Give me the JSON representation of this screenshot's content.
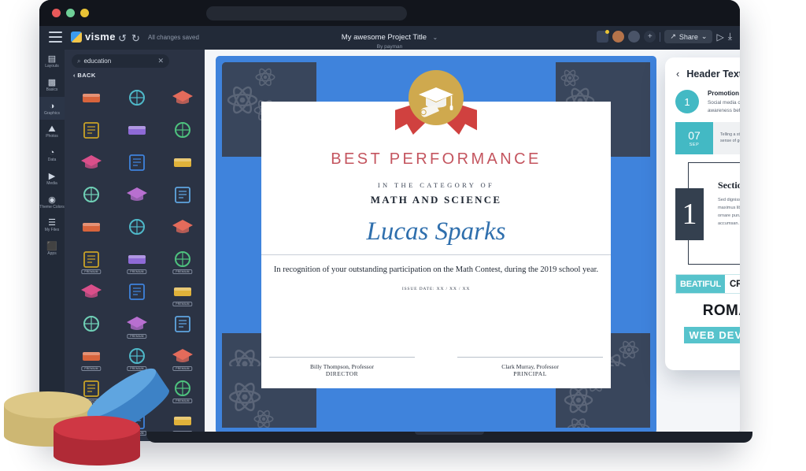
{
  "window": {
    "traffic_lights": [
      "red",
      "green",
      "yellow"
    ]
  },
  "toolbar": {
    "menu_icon": "hamburger-icon",
    "brand": "visme",
    "undo": "↺",
    "redo": "↻",
    "save_status": "All changes saved",
    "doc_title": "My awesome Project Title",
    "doc_title_caret": "⌄",
    "doc_author": "By payman",
    "share_label": "Share",
    "share_icon": "↗",
    "share_caret": "⌄",
    "present_icon": "▷",
    "download_icon": "⤓",
    "comments_icon": "❐",
    "avatar_plus": "+"
  },
  "rail": {
    "items": [
      {
        "label": "Layouts",
        "glyph": "▤",
        "icon": "layouts-icon",
        "active": false
      },
      {
        "label": "Basics",
        "glyph": "▩",
        "icon": "basics-icon",
        "active": false
      },
      {
        "label": "Graphics",
        "glyph": "◑",
        "icon": "graphics-icon",
        "active": true
      },
      {
        "label": "Photos",
        "glyph": "⛰",
        "icon": "photos-icon",
        "active": false
      },
      {
        "label": "Data",
        "glyph": "◔",
        "icon": "data-icon",
        "active": false
      },
      {
        "label": "Media",
        "glyph": "▶",
        "icon": "media-icon",
        "active": false
      },
      {
        "label": "Theme Colors",
        "glyph": "◉",
        "icon": "theme-colors-icon",
        "active": false
      },
      {
        "label": "My Files",
        "glyph": "☰",
        "icon": "my-files-icon",
        "active": false
      },
      {
        "label": "Apps",
        "glyph": "⬛",
        "icon": "apps-icon",
        "active": false
      }
    ]
  },
  "graphics_panel": {
    "search_value": "education",
    "search_placeholder": "Search",
    "search_icon": "⌕",
    "clear_icon": "✕",
    "back_label": "‹ BACK",
    "premium_badge": "PREMIUM",
    "items": [
      {
        "name": "ruler-icon",
        "premium": false
      },
      {
        "name": "pen-icon",
        "premium": false
      },
      {
        "name": "graduation-cap-icon",
        "premium": false
      },
      {
        "name": "pencil-icon",
        "premium": false
      },
      {
        "name": "fountain-pen-icon",
        "premium": false
      },
      {
        "name": "books-stack-icon",
        "premium": false
      },
      {
        "name": "notebook-icon",
        "premium": false
      },
      {
        "name": "glasses-icon",
        "premium": false
      },
      {
        "name": "calculator-icon",
        "premium": false
      },
      {
        "name": "money-icon",
        "premium": false
      },
      {
        "name": "laptop-icon",
        "premium": false
      },
      {
        "name": "brain-icon",
        "premium": false
      },
      {
        "name": "paintbrush-icon",
        "premium": false
      },
      {
        "name": "certificate-icon",
        "premium": false
      },
      {
        "name": "chart-icon",
        "premium": false
      },
      {
        "name": "open-book-icon",
        "premium": true
      },
      {
        "name": "textbook-icon",
        "premium": true
      },
      {
        "name": "abacus-icon",
        "premium": true
      },
      {
        "name": "tweezers-icon",
        "premium": false
      },
      {
        "name": "marker-icon",
        "premium": false
      },
      {
        "name": "microscope-icon",
        "premium": true
      },
      {
        "name": "paper-sheet-icon",
        "premium": false
      },
      {
        "name": "trophy-icon",
        "premium": true
      },
      {
        "name": "diamond-icon",
        "premium": false
      },
      {
        "name": "globe-grid-icon",
        "premium": true
      },
      {
        "name": "world-map-icon",
        "premium": true
      },
      {
        "name": "university-icon",
        "premium": true
      },
      {
        "name": "graduation-cap-alt-icon",
        "premium": true
      },
      {
        "name": "gift-box-icon",
        "premium": true
      },
      {
        "name": "calculator-alt-icon",
        "premium": true
      },
      {
        "name": "abacus-green-icon",
        "premium": true
      },
      {
        "name": "calculator-teal-icon",
        "premium": true
      },
      {
        "name": "globe-purple-icon",
        "premium": true
      },
      {
        "name": "globe-silver-icon",
        "premium": true
      },
      {
        "name": "whiteboard-icon",
        "premium": false
      },
      {
        "name": "scroll-icon",
        "premium": false
      }
    ]
  },
  "certificate": {
    "award_title": "BEST PERFORMANCE",
    "category_label": "IN THE CATEGORY OF",
    "category": "MATH AND SCIENCE",
    "recipient": "Lucas Sparks",
    "description": "In recognition of your outstanding participation on the Math Contest, during the 2019 school year.",
    "issue_date": "ISSUE DATE: XX / XX / XX",
    "seal_icon": "graduation-medal-icon",
    "signatures": [
      {
        "name": "Billy Thompson, Professor",
        "role": "DIRECTOR"
      },
      {
        "name": "Clark Murray, Professor",
        "role": "PRINCIPAL"
      }
    ],
    "colors": {
      "border": "#3f83dc",
      "corner": "#39465c",
      "award": "#c4555f",
      "name": "#2f6fad",
      "seal": "#cfa94e",
      "ribbon": "#d0413f"
    }
  },
  "right_panel": {
    "back_icon": "‹",
    "title": "Header Text",
    "promotion": {
      "number": "1",
      "title": "Promotion",
      "text": "Social media can use to increase awareness before an event."
    },
    "date_card": {
      "day": "07",
      "month": "SEP",
      "text": "Telling a story behind a product gives a sense of genuineness."
    },
    "section_card": {
      "number": "1",
      "title": "Section",
      "text": "Sed dignissim elementum quam, vel maximus libero pharetra quis. Morbi ornare purus a metus maximus accumsan."
    },
    "logo_card": {
      "left": "BEATIFUL",
      "right": "CREATIVE"
    },
    "romanie": "ROMANIE",
    "webdev": "WEB DEVELOPER",
    "accent_color": "#43b9c4"
  },
  "props": {
    "cylinders": [
      {
        "name": "tan-cylinder",
        "color": "#ddc887"
      },
      {
        "name": "red-cylinder",
        "color": "#cf3744"
      },
      {
        "name": "blue-cylinder",
        "color": "#5fa5e0"
      }
    ]
  }
}
